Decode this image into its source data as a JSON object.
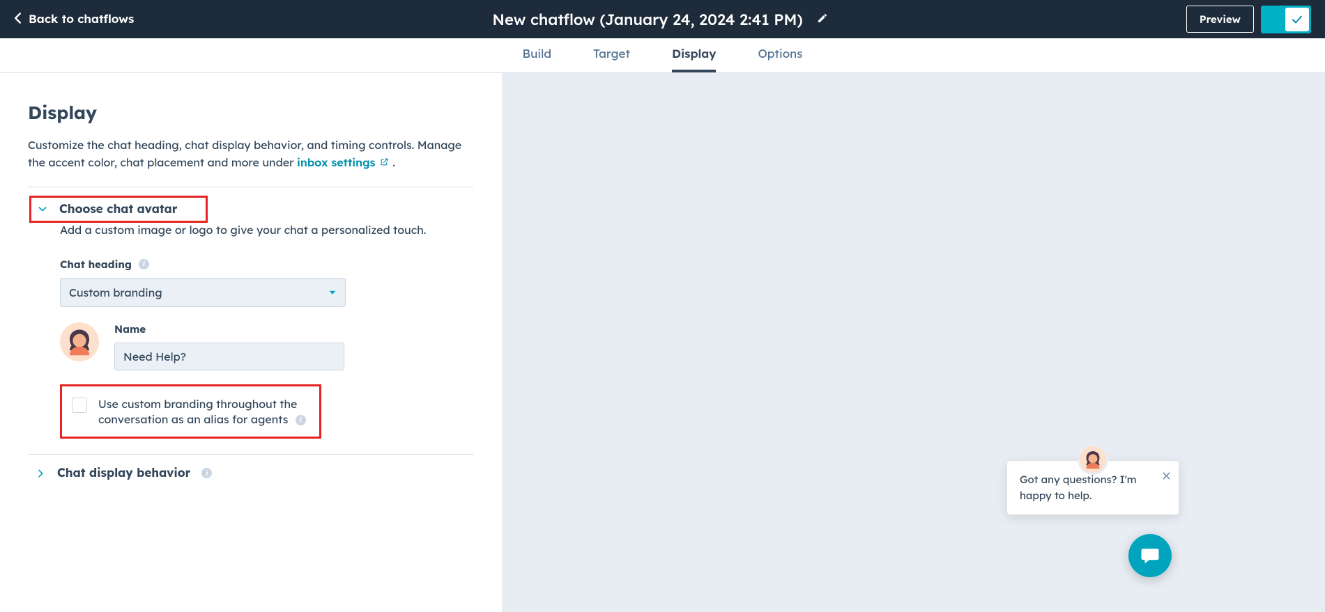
{
  "header": {
    "back_label": "Back to chatflows",
    "title": "New chatflow (January 24, 2024 2:41 PM)",
    "preview_label": "Preview"
  },
  "tabs": {
    "build": "Build",
    "target": "Target",
    "display": "Display",
    "options": "Options",
    "active": "display"
  },
  "page": {
    "title": "Display",
    "desc_part1": "Customize the chat heading, chat display behavior, and timing controls. Manage the accent color, chat placement and more under ",
    "inbox_link": "inbox settings",
    "desc_part2": " ."
  },
  "section_avatar": {
    "title": "Choose chat avatar",
    "desc": "Add a custom image or logo to give your chat a personalized touch.",
    "heading_label": "Chat heading",
    "heading_value": "Custom branding",
    "name_label": "Name",
    "name_value": "Need Help?",
    "checkbox_label": "Use custom branding throughout the conversation as an alias for agents"
  },
  "section_behavior": {
    "title": "Chat display behavior"
  },
  "preview": {
    "bubble_text": "Got any questions? I'm happy to help."
  }
}
